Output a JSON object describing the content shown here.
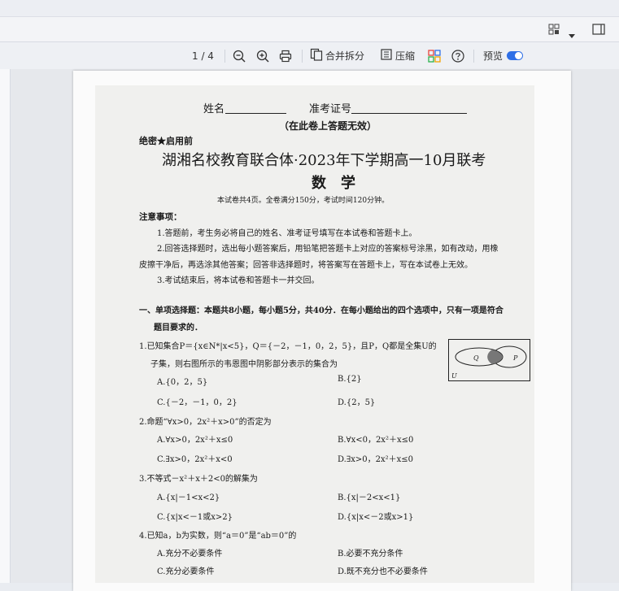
{
  "toolbar": {
    "page_indicator": "1 / 4",
    "merge_split_label": "合并拆分",
    "compress_label": "压缩",
    "preview_label": "预览",
    "preview_enabled": true
  },
  "document": {
    "name_field": "姓名",
    "exam_id_field": "准考证号",
    "notice_invalid": "（在此卷上答题无效）",
    "secret": "绝密★启用前",
    "title": "湖湘名校教育联合体·2023年下学期高一10月联考",
    "subject": "数　学",
    "info": "本试卷共4页。全卷满分150分，考试时间120分钟。",
    "notes_heading": "注意事项：",
    "notes": [
      "1.答题前，考生务必将自己的姓名、准考证号填写在本试卷和答题卡上。",
      "2.回答选择题时，选出每小题答案后，用铅笔把答题卡上对应的答案标号涂黑，如有改动，用橡",
      "皮擦干净后，再选涂其他答案；回答非选择题时，将答案写在答题卡上，写在本试卷上无效。",
      "3.考试结束后，将本试卷和答题卡一并交回。"
    ],
    "section1_line1": "一、单项选择题：本题共8小题，每小题5分，共40分．在每小题给出的四个选项中，只有一项是符合",
    "section1_line2": "题目要求的．",
    "q1_line1": "1.已知集合P＝{x∈N*|x<5}，Q＝{－2，－1，0，2，5}，且P，Q都是全集U的",
    "q1_line2": "子集，则右图所示的韦恩图中阴影部分表示的集合为",
    "q1_options": [
      "A.{0，2，5}",
      "B.{2}",
      "C.{－2，－1，0，2}",
      "D.{2，5}"
    ],
    "venn": {
      "p": "P",
      "q": "Q",
      "u": "U"
    },
    "q2": "2.命题“∀x>0，2x²＋x>0”的否定为",
    "q2_options": [
      "A.∀x>0，2x²＋x≤0",
      "B.∀x<0，2x²＋x≤0",
      "C.∃x>0，2x²＋x<0",
      "D.∃x>0，2x²＋x≤0"
    ],
    "q3": "3.不等式－x²＋x＋2<0的解集为",
    "q3_options": [
      "A.{x|－1<x<2}",
      "B.{x|－2<x<1}",
      "C.{x|x<－1或x>2}",
      "D.{x|x<－2或x>1}"
    ],
    "q4": "4.已知a，b为实数，则“a＝0”是“ab＝0”的",
    "q4_options": [
      "A.充分不必要条件",
      "B.必要不充分条件",
      "C.充分必要条件",
      "D.既不充分也不必要条件"
    ]
  }
}
